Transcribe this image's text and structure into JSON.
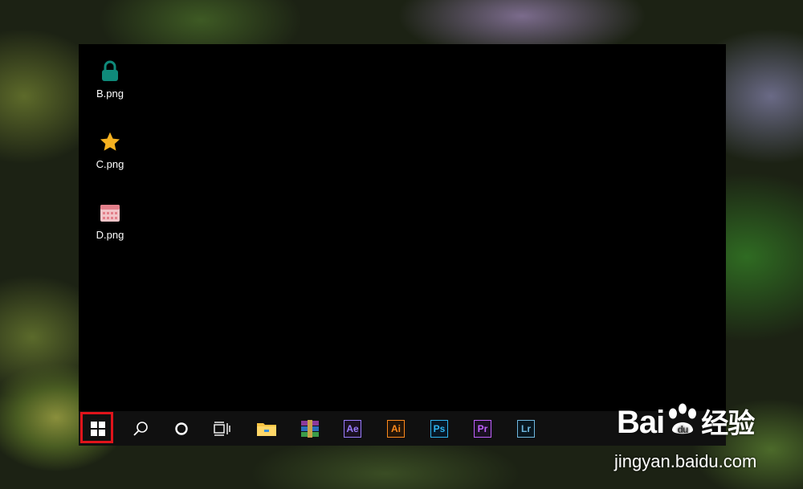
{
  "desktop": {
    "icons": [
      {
        "label": "B.png",
        "icon": "lock-icon",
        "color": "#0f8a7a"
      },
      {
        "label": "C.png",
        "icon": "star-icon",
        "color": "#f5b120"
      },
      {
        "label": "D.png",
        "icon": "calendar-icon",
        "color": "#e7a1a8"
      }
    ]
  },
  "taskbar": {
    "start": {
      "icon": "windows-logo-icon",
      "highlight_color": "#e0141b"
    },
    "search": {
      "icon": "search-icon"
    },
    "cortana": {
      "icon": "cortana-circle-icon"
    },
    "task_view": {
      "icon": "task-view-icon"
    },
    "file_explorer": {
      "icon": "folder-icon",
      "color": "#f6c343"
    },
    "winrar": {
      "icon": "winrar-icon"
    },
    "apps": [
      {
        "label": "Ae",
        "icon": "after-effects-icon",
        "color": "#9a7cff"
      },
      {
        "label": "Ai",
        "icon": "illustrator-icon",
        "color": "#ff8a1c"
      },
      {
        "label": "Ps",
        "icon": "photoshop-icon",
        "color": "#2fb5f2"
      },
      {
        "label": "Pr",
        "icon": "premiere-icon",
        "color": "#c061ff"
      },
      {
        "label": "Lr",
        "icon": "lightroom-icon",
        "color": "#6fb8e0"
      }
    ]
  },
  "watermark": {
    "brand": "Bai",
    "brand_suffix": "经验",
    "url": "jingyan.baidu.com"
  }
}
